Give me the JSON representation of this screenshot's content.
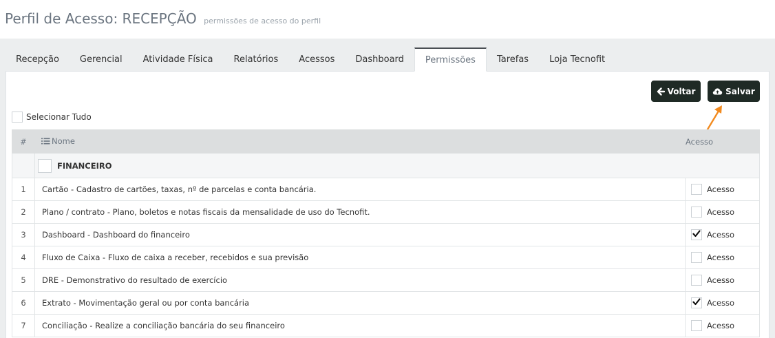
{
  "header": {
    "title": "Perfil de Acesso: RECEPÇÃO",
    "subtitle": "permissões de acesso do perfil"
  },
  "tabs": [
    {
      "label": "Recepção"
    },
    {
      "label": "Gerencial"
    },
    {
      "label": "Atividade Física"
    },
    {
      "label": "Relatórios"
    },
    {
      "label": "Acessos"
    },
    {
      "label": "Dashboard"
    },
    {
      "label": "Permissões",
      "active": true
    },
    {
      "label": "Tarefas"
    },
    {
      "label": "Loja Tecnofit"
    }
  ],
  "actions": {
    "voltar_label": "Voltar",
    "salvar_label": "Salvar"
  },
  "select_all_label": "Selecionar Tudo",
  "table": {
    "col_num": "#",
    "col_name": "Nome",
    "col_acesso": "Acesso",
    "group_label": "FINANCEIRO",
    "access_label": "Acesso",
    "rows": [
      {
        "num": "1",
        "name": "Cartão - Cadastro de cartões, taxas, nº de parcelas e conta bancária.",
        "checked": false
      },
      {
        "num": "2",
        "name": "Plano / contrato - Plano, boletos e notas fiscais da mensalidade de uso do Tecnofit.",
        "checked": false
      },
      {
        "num": "3",
        "name": "Dashboard - Dashboard do financeiro",
        "checked": true
      },
      {
        "num": "4",
        "name": "Fluxo de Caixa - Fluxo de caixa a receber, recebidos e sua previsão",
        "checked": false
      },
      {
        "num": "5",
        "name": "DRE - Demonstrativo do resultado de exercício",
        "checked": false
      },
      {
        "num": "6",
        "name": "Extrato - Movimentação geral ou por conta bancária",
        "checked": true
      },
      {
        "num": "7",
        "name": "Conciliação - Realize a conciliação bancária do seu financeiro",
        "checked": false
      }
    ]
  },
  "colors": {
    "button_bg": "#1f2a25",
    "annotation_arrow": "#f28a1e"
  }
}
